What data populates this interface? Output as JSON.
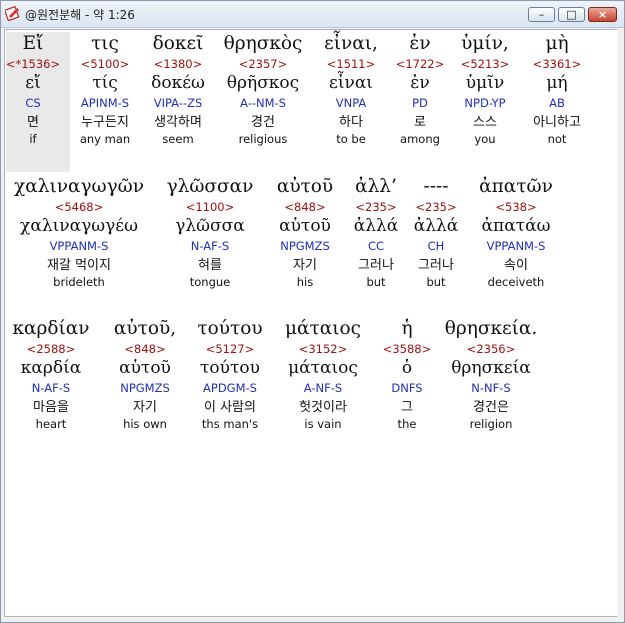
{
  "window": {
    "title": "@원전분해 - 약 1:26"
  },
  "rows": [
    {
      "words": [
        {
          "greek": "Εἴ",
          "strong": "<*1536>",
          "lemma": "εἴ",
          "parse": "CS",
          "kor": "면",
          "eng": "if"
        },
        {
          "greek": "τις",
          "strong": "<5100>",
          "lemma": "τίς",
          "parse": "APINM-S",
          "kor": "누구든지",
          "eng": "any man"
        },
        {
          "greek": "δοκεῖ",
          "strong": "<1380>",
          "lemma": "δοκέω",
          "parse": "VIPA--ZS",
          "kor": "생각하며",
          "eng": "seem"
        },
        {
          "greek": "θρησκὸς",
          "strong": "<2357>",
          "lemma": "θρῆσκος",
          "parse": "A--NM-S",
          "kor": "경건",
          "eng": "religious"
        },
        {
          "greek": "εἶναι,",
          "strong": "<1511>",
          "lemma": "εἶναι",
          "parse": "VNPA",
          "kor": "하다",
          "eng": "to be"
        },
        {
          "greek": "ἐν",
          "strong": "<1722>",
          "lemma": "ἐν",
          "parse": "PD",
          "kor": "로",
          "eng": "among"
        },
        {
          "greek": "ὑμίν,",
          "strong": "<5213>",
          "lemma": "ὑμῖν",
          "parse": "NPD-YP",
          "kor": "스스",
          "eng": "you"
        },
        {
          "greek": "μὴ",
          "strong": "<3361>",
          "lemma": "μή",
          "parse": "AB",
          "kor": "아니하고",
          "eng": "not"
        }
      ]
    },
    {
      "words": [
        {
          "greek": "χαλιναγωγῶν",
          "strong": "<5468>",
          "lemma": "χαλιναγωγέω",
          "parse": "VPPANM-S",
          "kor": "재갈 먹이지",
          "eng": "brideleth"
        },
        {
          "greek": "γλῶσσαν",
          "strong": "<1100>",
          "lemma": "γλῶσσα",
          "parse": "N-AF-S",
          "kor": "혀를",
          "eng": "tongue"
        },
        {
          "greek": "αὐτοῦ",
          "strong": "<848>",
          "lemma": "αὑτοῦ",
          "parse": "NPGMZS",
          "kor": "자기",
          "eng": "his"
        },
        {
          "greek": "ἀλλ’",
          "strong": "<235>",
          "lemma": "ἀλλά",
          "parse": "CC",
          "kor": "그러나",
          "eng": "but"
        },
        {
          "greek": "----",
          "strong": "<235>",
          "lemma": "ἀλλά",
          "parse": "CH",
          "kor": "그러나",
          "eng": "but"
        },
        {
          "greek": "ἀπατῶν",
          "strong": "<538>",
          "lemma": "ἀπατάω",
          "parse": "VPPANM-S",
          "kor": "속이",
          "eng": "deceiveth"
        }
      ]
    },
    {
      "words": [
        {
          "greek": "καρδίαν",
          "strong": "<2588>",
          "lemma": "καρδία",
          "parse": "N-AF-S",
          "kor": "마음을",
          "eng": "heart"
        },
        {
          "greek": "αὐτοῦ,",
          "strong": "<848>",
          "lemma": "αὑτοῦ",
          "parse": "NPGMZS",
          "kor": "자기",
          "eng": "his own"
        },
        {
          "greek": "τούτου",
          "strong": "<5127>",
          "lemma": "τούτου",
          "parse": "APDGM-S",
          "kor": "이 사람의",
          "eng": "ths man's"
        },
        {
          "greek": "μάταιος",
          "strong": "<3152>",
          "lemma": "μάταιος",
          "parse": "A-NF-S",
          "kor": "헛것이라",
          "eng": "is vain"
        },
        {
          "greek": "ἡ",
          "strong": "<3588>",
          "lemma": "ὁ",
          "parse": "DNFS",
          "kor": "그",
          "eng": "the"
        },
        {
          "greek": "θρησκεία.",
          "strong": "<2356>",
          "lemma": "θρησκεία",
          "parse": "N-NF-S",
          "kor": "경건은",
          "eng": "religion"
        }
      ]
    }
  ]
}
